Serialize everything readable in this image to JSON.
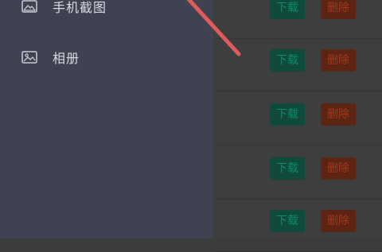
{
  "drawer": {
    "items": [
      {
        "label": "手机截图",
        "icon": "image-icon"
      },
      {
        "label": "相册",
        "icon": "photo-album-icon"
      }
    ]
  },
  "list": {
    "rows": [
      {
        "download_label": "下载",
        "delete_label": "删除"
      },
      {
        "download_label": "下载",
        "delete_label": "删除"
      },
      {
        "download_label": "下载",
        "delete_label": "删除"
      },
      {
        "download_label": "下载",
        "delete_label": "删除"
      },
      {
        "download_label": "下载",
        "delete_label": "删除"
      }
    ]
  },
  "colors": {
    "drawer_bg": "#3f4351",
    "download_btn": "#0f4a3c",
    "delete_btn": "#5e2413",
    "annotation_arrow": "#e05a5a"
  }
}
